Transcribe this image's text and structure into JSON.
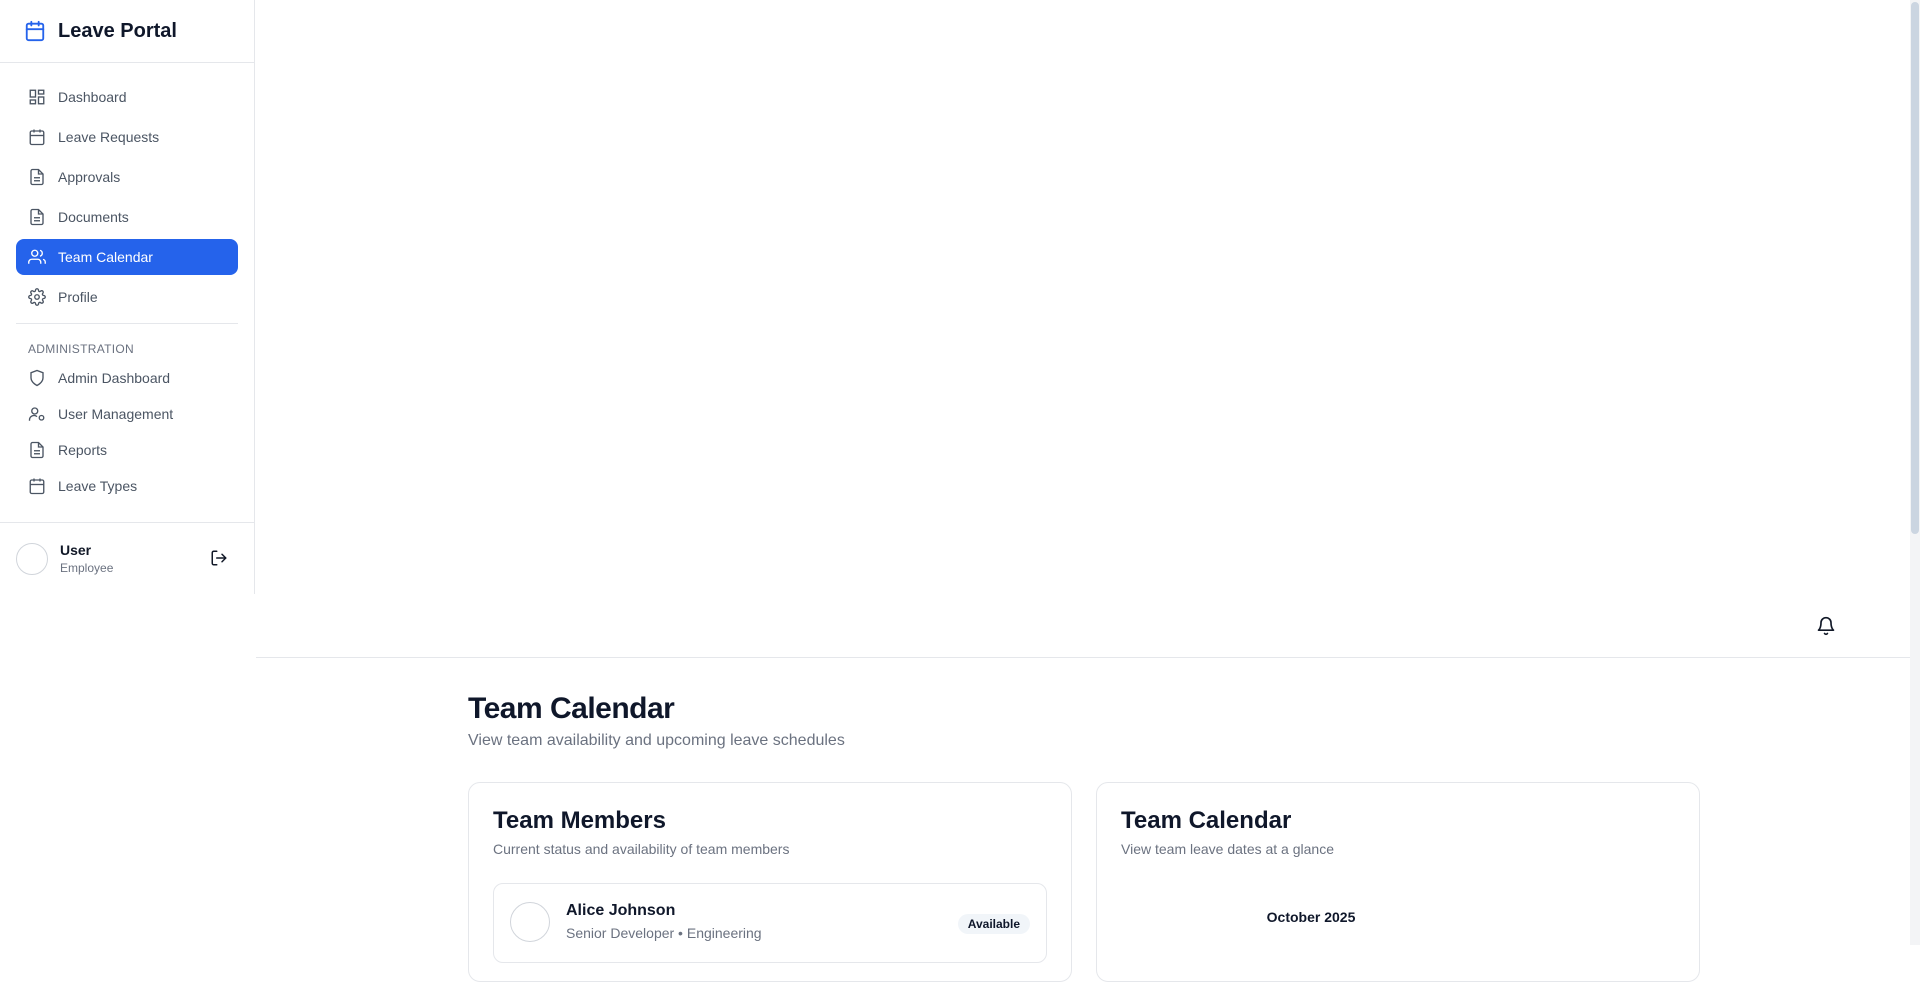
{
  "app": {
    "title": "Leave Portal"
  },
  "sidebar": {
    "items": [
      {
        "label": "Dashboard",
        "icon": "grid-icon",
        "active": false
      },
      {
        "label": "Leave Requests",
        "icon": "calendar-icon",
        "active": false
      },
      {
        "label": "Approvals",
        "icon": "file-icon",
        "active": false
      },
      {
        "label": "Documents",
        "icon": "file-icon",
        "active": false
      },
      {
        "label": "Team Calendar",
        "icon": "users-icon",
        "active": true
      },
      {
        "label": "Profile",
        "icon": "gear-icon",
        "active": false
      }
    ],
    "admin_label": "ADMINISTRATION",
    "admin_items": [
      {
        "label": "Admin Dashboard",
        "icon": "shield-icon"
      },
      {
        "label": "User Management",
        "icon": "user-cog-icon"
      },
      {
        "label": "Reports",
        "icon": "file-icon"
      },
      {
        "label": "Leave Types",
        "icon": "calendar-icon"
      }
    ]
  },
  "user": {
    "name": "User",
    "role": "Employee"
  },
  "page": {
    "title": "Team Calendar",
    "subtitle": "View team availability and upcoming leave schedules"
  },
  "members_card": {
    "title": "Team Members",
    "subtitle": "Current status and availability of team members",
    "members": [
      {
        "name": "Alice Johnson",
        "role": "Senior Developer • Engineering",
        "status": "Available"
      }
    ]
  },
  "calendar_card": {
    "title": "Team Calendar",
    "subtitle": "View team leave dates at a glance",
    "month": "October 2025"
  },
  "colors": {
    "accent": "#2563eb",
    "border": "#e5e7eb",
    "muted": "#6b7280"
  }
}
